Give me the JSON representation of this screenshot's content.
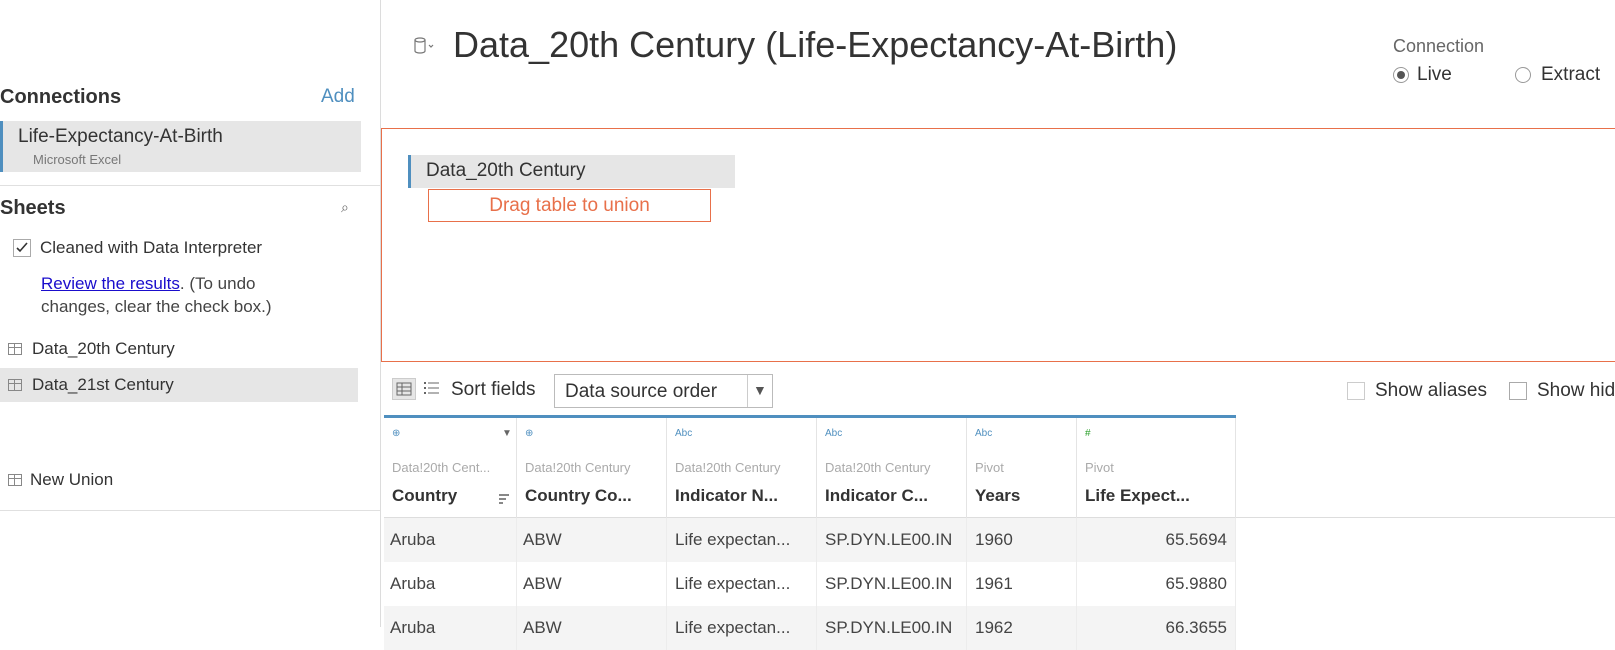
{
  "toolbar": {
    "icons": [
      "tableau-logo-icon",
      "back-icon",
      "forward-icon",
      "save-icon",
      "refresh-icon"
    ]
  },
  "left": {
    "connections_title": "Connections",
    "add_label": "Add",
    "connection": {
      "name": "Life-Expectancy-At-Birth",
      "type": "Microsoft Excel"
    },
    "sheets_title": "Sheets",
    "interpreter_label": "Cleaned with Data Interpreter",
    "review_link": "Review the results",
    "review_rest_1": ". (To undo",
    "review_rest_2": "changes, clear the check box.)",
    "sheets": [
      "Data_20th Century",
      "Data_21st Century"
    ],
    "new_union": "New Union"
  },
  "header": {
    "title": "Data_20th Century (Life-Expectancy-At-Birth)",
    "connection_label": "Connection",
    "live_label": "Live",
    "extract_label": "Extract"
  },
  "canvas": {
    "table_name": "Data_20th Century",
    "union_hint": "Drag table to union"
  },
  "grid_toolbar": {
    "sort_label": "Sort fields",
    "sort_value": "Data source order",
    "show_aliases": "Show aliases",
    "show_hidden": "Show hid"
  },
  "columns": [
    {
      "type": "⊕",
      "source": "Data!20th Cent...",
      "name": "Country"
    },
    {
      "type": "⊕",
      "source": "Data!20th Century",
      "name": "Country Co..."
    },
    {
      "type": "Abc",
      "source": "Data!20th Century",
      "name": "Indicator N..."
    },
    {
      "type": "Abc",
      "source": "Data!20th Century",
      "name": "Indicator C..."
    },
    {
      "type": "Abc",
      "source": "Pivot",
      "name": "Years"
    },
    {
      "type": "#",
      "source": "Pivot",
      "name": "Life Expect..."
    }
  ],
  "rows": [
    [
      "Aruba",
      "ABW",
      "Life expectan...",
      "SP.DYN.LE00.IN",
      "1960",
      "65.5694"
    ],
    [
      "Aruba",
      "ABW",
      "Life expectan...",
      "SP.DYN.LE00.IN",
      "1961",
      "65.9880"
    ],
    [
      "Aruba",
      "ABW",
      "Life expectan...",
      "SP.DYN.LE00.IN",
      "1962",
      "66.3655"
    ]
  ],
  "colors": {
    "accent_blue": "#4f8fbf",
    "union_orange": "#e8704a",
    "link_blue": "#1a0dcc"
  }
}
